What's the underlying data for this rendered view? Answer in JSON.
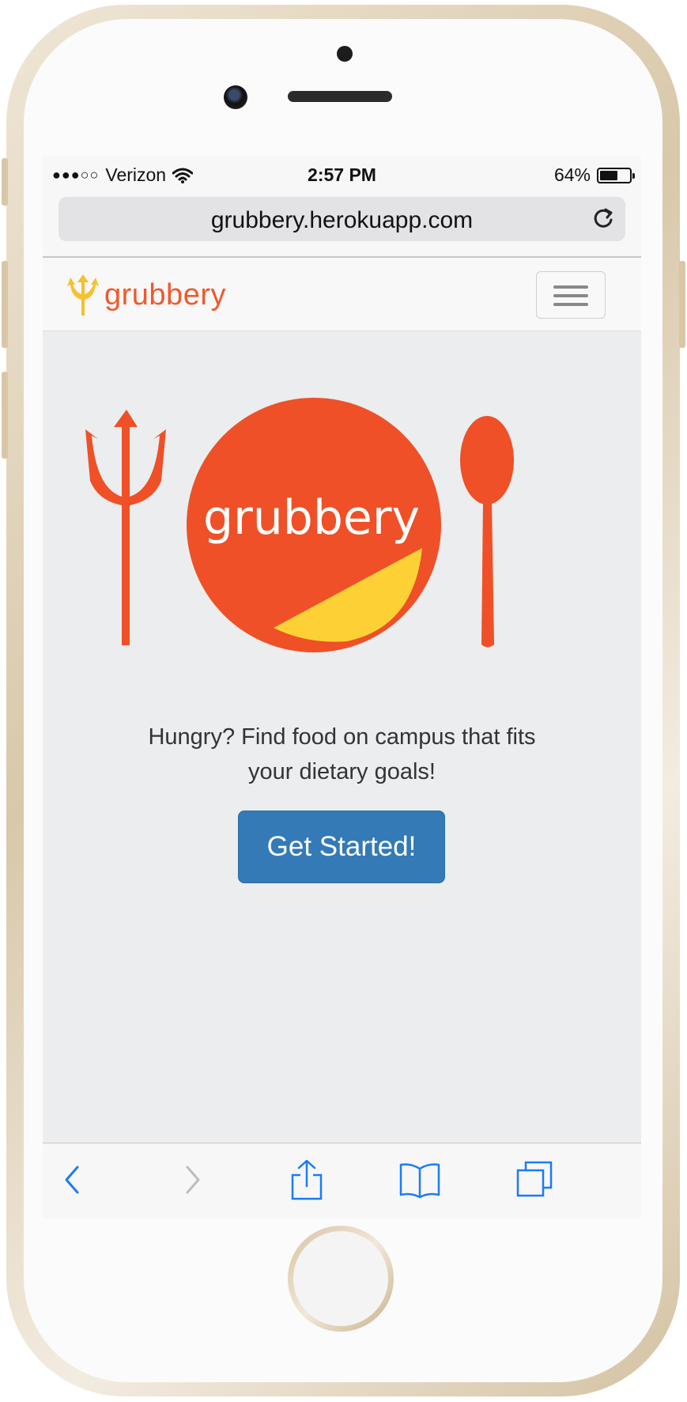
{
  "status_bar": {
    "signal": "●●●○○",
    "carrier": "Verizon",
    "time": "2:57 PM",
    "battery_percent": "64%",
    "battery_level": 0.64
  },
  "browser": {
    "url": "grubbery.herokuapp.com",
    "reload_icon": "reload-icon",
    "toolbar_icons": [
      "back-icon",
      "forward-icon",
      "share-icon",
      "bookmarks-icon",
      "tabs-icon"
    ]
  },
  "navbar": {
    "brand_text": "grubbery",
    "menu_icon": "hamburger-menu-icon"
  },
  "hero": {
    "logo_text": "grubbery",
    "tagline_line1": "Hungry? Find food on campus that fits",
    "tagline_line2": "your dietary goals!",
    "cta_label": "Get Started!"
  },
  "colors": {
    "brand_orange": "#ef5027",
    "brand_yellow": "#fdd135",
    "cta_blue": "#337ab7",
    "ios_blue": "#1a7cf5",
    "page_bg": "#ebedee"
  }
}
